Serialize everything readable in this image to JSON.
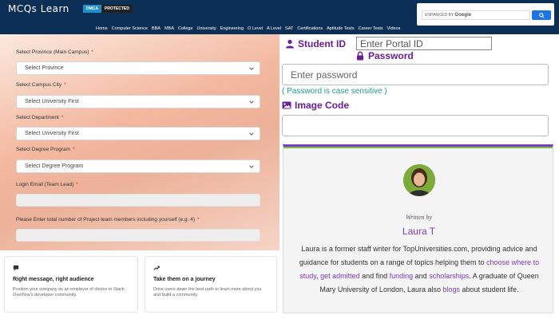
{
  "header": {
    "logo": "MCQs Learn",
    "badge_left": "DMCA",
    "badge_right": "PROTECTED",
    "search_prefix": "ENHANCED BY",
    "search_brand": "Google",
    "nav": [
      "Home",
      "Computer Science",
      "BBA",
      "MBA",
      "College",
      "University",
      "Engineering",
      "O Level",
      "A Level",
      "SAT",
      "Certifications",
      "Aptitude Tests",
      "Career Tests",
      "Videos"
    ]
  },
  "form": {
    "province_label": "Select Province (Main Campus)",
    "province_value": "Select Province",
    "city_label": "Select Campus City",
    "city_value": "Select University First",
    "department_label": "Select Department",
    "department_value": "Select University First",
    "degree_label": "Select Degree Program",
    "degree_value": "Select Degree Program",
    "email_label": "Login Email (Team Lead)",
    "members_label": "Please Enter total number of Project team members including yourself (e.g. 4)",
    "required_mark": "*"
  },
  "cards": [
    {
      "title": "Right message, right audience",
      "text": "Position your company as an employer of choice to Stack Overflow's developer community."
    },
    {
      "title": "Take them on a journey",
      "text": "Drive users down the best path to learn more about you and build a community."
    }
  ],
  "login": {
    "student_id_label": "Student ID",
    "portal_placeholder": "Enter Portal ID",
    "password_label": "Password",
    "password_placeholder": "Enter password",
    "hint": "( Password is case sensitive )",
    "image_code_label": "Image Code"
  },
  "author": {
    "written_by": "Written by",
    "name": "Laura T",
    "bio_1": "Laura is a former staff writer for TopUniversities.com, providing advice and guidance for students on a range of topics helping them to ",
    "link_1": "choose where to study",
    "sep_1": ", ",
    "link_2": "get admitted",
    "bio_2": " and find ",
    "link_3": "funding",
    "bio_3": " and ",
    "link_4": "scholarships",
    "bio_4": ". A graduate of Queen Mary University of London, Laura also ",
    "link_5": "blogs",
    "bio_5": " about student life."
  },
  "colors": {
    "header_bg": "#0c2f55",
    "accent_purple": "#7d3cc5",
    "label_purple": "#6a1d9b",
    "hint_teal": "#1f9c8f",
    "required_red": "#dd3333"
  }
}
